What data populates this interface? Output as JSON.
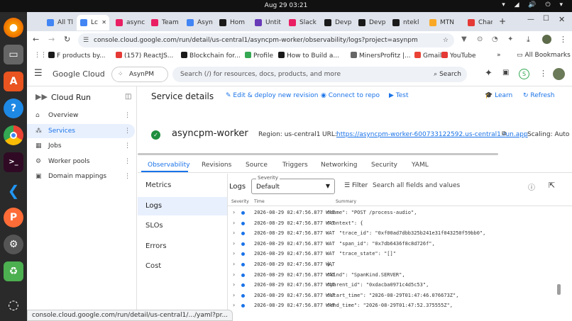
{
  "system": {
    "clock": "Aug 29  03:21",
    "tray": "▾ ◢ 🔊 ⏻ ▾"
  },
  "dock": [
    "firefox",
    "files",
    "app-center",
    "help",
    "chrome",
    "terminal",
    "vscode",
    "postman",
    "settings",
    "trash",
    "ubuntu"
  ],
  "browser": {
    "tabs": [
      {
        "label": "All Tl",
        "color": "#4285f4"
      },
      {
        "label": "Lc",
        "color": "#4285f4",
        "active": true
      },
      {
        "label": "async",
        "color": "#e91e63"
      },
      {
        "label": "Team",
        "color": "#e91e63"
      },
      {
        "label": "Asyn",
        "color": "#4285f4"
      },
      {
        "label": "Hom",
        "color": "#1a1a1a"
      },
      {
        "label": "Untit",
        "color": "#673ab7"
      },
      {
        "label": "Slack",
        "color": "#e91e63"
      },
      {
        "label": "Devp",
        "color": "#1a1a1a"
      },
      {
        "label": "Devp",
        "color": "#1a1a1a"
      },
      {
        "label": "ntekl",
        "color": "#1a1a1a"
      },
      {
        "label": "MTN",
        "color": "#f9a825"
      },
      {
        "label": "Chan",
        "color": "#e53935"
      }
    ],
    "url": "console.cloud.google.com/run/detail/us-central1/asyncpm-worker/observability/logs?project=asynpm",
    "bookmarks": [
      {
        "label": "F products by...",
        "color": "#1a1a1a"
      },
      {
        "label": "(157) ReactJS...",
        "color": "#e53935"
      },
      {
        "label": "Blockchain for...",
        "color": "#1a1a1a"
      },
      {
        "label": "Profile",
        "color": "#34a853"
      },
      {
        "label": "How to Build a...",
        "color": "#1a1a1a"
      },
      {
        "label": "MinersProfitz |...",
        "color": "#666"
      },
      {
        "label": "Gmail",
        "color": "#ea4335"
      },
      {
        "label": "YouTube",
        "color": "#e53935"
      }
    ],
    "all_bookmarks": "All Bookmarks",
    "status_url": "console.cloud.google.com/run/detail/us-central1/.../yaml?pr..."
  },
  "console": {
    "brand": "Google Cloud",
    "project": "AsynPM",
    "search_placeholder": "Search (/) for resources, docs, products, and more",
    "search_button": "Search",
    "avatar_letter": "S"
  },
  "nav": {
    "product": "Cloud Run",
    "items": [
      {
        "label": "Overview",
        "icon": "⌂"
      },
      {
        "label": "Services",
        "icon": "⁂",
        "selected": true
      },
      {
        "label": "Jobs",
        "icon": "▦"
      },
      {
        "label": "Worker pools",
        "icon": "⚙"
      },
      {
        "label": "Domain mappings",
        "icon": "▣"
      }
    ]
  },
  "service": {
    "heading": "Service details",
    "edit": "Edit & deploy new revision",
    "connect": "Connect to repo",
    "test": "Test",
    "learn": "Learn",
    "refresh": "Refresh",
    "name": "asyncpm-worker",
    "region": "Region: us-central1",
    "url_label": "URL:",
    "url": "https://asyncpm-worker-600733122592.us-central1.run.app",
    "scaling": "Scaling: Auto"
  },
  "tabs": [
    "Observability",
    "Revisions",
    "Source",
    "Triggers",
    "Networking",
    "Security",
    "YAML"
  ],
  "subnav": [
    "Metrics",
    "Logs",
    "SLOs",
    "Errors",
    "Cost"
  ],
  "logs": {
    "title": "Logs",
    "severity_label": "Severity",
    "severity_value": "Default",
    "filter": "Filter",
    "filter_placeholder": "Search all fields and values",
    "columns": [
      "Severity",
      "Time",
      "Summary"
    ],
    "rows": [
      {
        "time": "2026-08-29 02:47:56.877 WAT",
        "summary": "\"name\": \"POST /process-audio\","
      },
      {
        "time": "2026-08-29 02:47:56.877 WAT",
        "summary": "\"context\": {"
      },
      {
        "time": "2026-08-29 02:47:56.877 WAT",
        "summary": "    \"trace_id\": \"0xf00ad7dbb325b241e31f043250f59bb0\","
      },
      {
        "time": "2026-08-29 02:47:56.877 WAT",
        "summary": "    \"span_id\": \"0x7db6436f8c8d726f\","
      },
      {
        "time": "2026-08-29 02:47:56.877 WAT",
        "summary": "    \"trace_state\": \"[]\""
      },
      {
        "time": "2026-08-29 02:47:56.877 WAT",
        "summary": "},"
      },
      {
        "time": "2026-08-29 02:47:56.877 WAT",
        "summary": "\"kind\": \"SpanKind.SERVER\","
      },
      {
        "time": "2026-08-29 02:47:56.877 WAT",
        "summary": "\"parent_id\": \"0xdacba0971c4d5c53\","
      },
      {
        "time": "2026-08-29 02:47:56.877 WAT",
        "summary": "\"start_time\": \"2026-08-29T01:47:46.076673Z\","
      },
      {
        "time": "2026-08-29 02:47:56.877 WAT",
        "summary": "\"end_time\": \"2026-08-29T01:47:52.375555Z\","
      }
    ]
  }
}
